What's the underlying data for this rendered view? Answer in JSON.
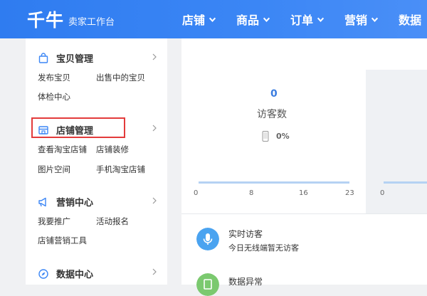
{
  "header": {
    "logo": "千牛",
    "subtitle": "卖家工作台",
    "nav": [
      {
        "label": "店铺"
      },
      {
        "label": "商品"
      },
      {
        "label": "订单"
      },
      {
        "label": "营销"
      },
      {
        "label": "数据"
      }
    ]
  },
  "sidebar": {
    "sections": [
      {
        "title": "宝贝管理",
        "icon": "bag-icon",
        "links": [
          "发布宝贝",
          "出售中的宝贝",
          "体检中心"
        ]
      },
      {
        "title": "店铺管理",
        "icon": "store-icon",
        "links": [
          "查看淘宝店铺",
          "店铺装修",
          "图片空间",
          "手机淘宝店铺"
        ]
      },
      {
        "title": "营销中心",
        "icon": "megaphone-icon",
        "links": [
          "我要推广",
          "活动报名",
          "店铺营销工具"
        ]
      },
      {
        "title": "数据中心",
        "icon": "compass-icon",
        "links": []
      }
    ]
  },
  "main": {
    "visitors": {
      "value": "0",
      "label": "访客数",
      "percent": "0%"
    },
    "chart_ticks": [
      "0",
      "8",
      "16",
      "23"
    ],
    "right_tick": "0",
    "realtime": {
      "title": "实时访客",
      "subtitle": "今日无线端暂无访客"
    },
    "anomaly": {
      "title": "数据异常"
    }
  },
  "colors": {
    "accent": "#3b86f5",
    "highlight": "#e33b3b",
    "icon_blue": "#4aa3f0",
    "icon_green": "#7bc96f"
  }
}
